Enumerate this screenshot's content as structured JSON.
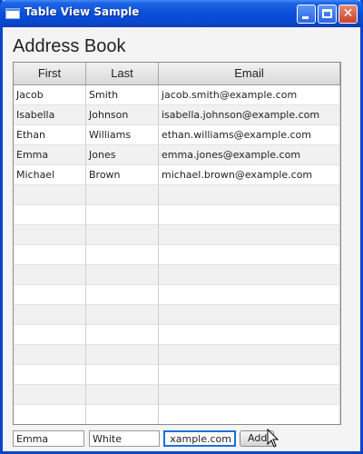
{
  "window": {
    "title": "Table View Sample"
  },
  "heading": "Address Book",
  "table": {
    "columns": [
      "First",
      "Last",
      "Email"
    ],
    "rows": [
      {
        "first": "Jacob",
        "last": "Smith",
        "email": "jacob.smith@example.com"
      },
      {
        "first": "Isabella",
        "last": "Johnson",
        "email": "isabella.johnson@example.com"
      },
      {
        "first": "Ethan",
        "last": "Williams",
        "email": "ethan.williams@example.com"
      },
      {
        "first": "Emma",
        "last": "Jones",
        "email": "emma.jones@example.com"
      },
      {
        "first": "Michael",
        "last": "Brown",
        "email": "michael.brown@example.com"
      }
    ],
    "empty_rows": 12
  },
  "form": {
    "first_value": "Emma",
    "last_value": "White",
    "email_value": "xample.com",
    "add_label": "Add"
  },
  "colors": {
    "titlebar": "#0a4fd8",
    "focus_border": "#1a6fe0",
    "row_alt": "#f1f1f1"
  }
}
